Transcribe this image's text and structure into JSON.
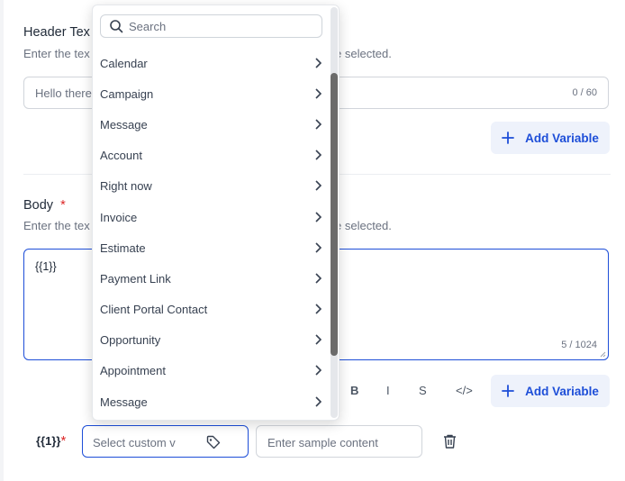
{
  "header": {
    "title": "Header Tex",
    "hint_left": "Enter the tex",
    "hint_right": "e selected.",
    "input_value": "Hello there",
    "counter": "0 / 60"
  },
  "add_variable_label": "Add Variable",
  "body": {
    "title": "Body",
    "required_mark": "*",
    "hint_left": "Enter the tex",
    "hint_right": "e selected.",
    "text": "{{1}}",
    "counter": "5 / 1024"
  },
  "format_buttons": {
    "bold": "B",
    "italic": "I",
    "strike": "S",
    "code": "</>"
  },
  "variable_row": {
    "label": "{{1}}",
    "required_mark": "*",
    "select_placeholder": "Select custom v",
    "sample_placeholder": "Enter sample content"
  },
  "dropdown": {
    "search_placeholder": "Search",
    "items": [
      "Calendar",
      "Campaign",
      "Message",
      "Account",
      "Right now",
      "Invoice",
      "Estimate",
      "Payment Link",
      "Client Portal Contact",
      "Opportunity",
      "Appointment",
      "Message"
    ]
  },
  "colors": {
    "accent": "#1d4ed8",
    "required": "#dc2626",
    "button_bg": "#eef2fb"
  }
}
